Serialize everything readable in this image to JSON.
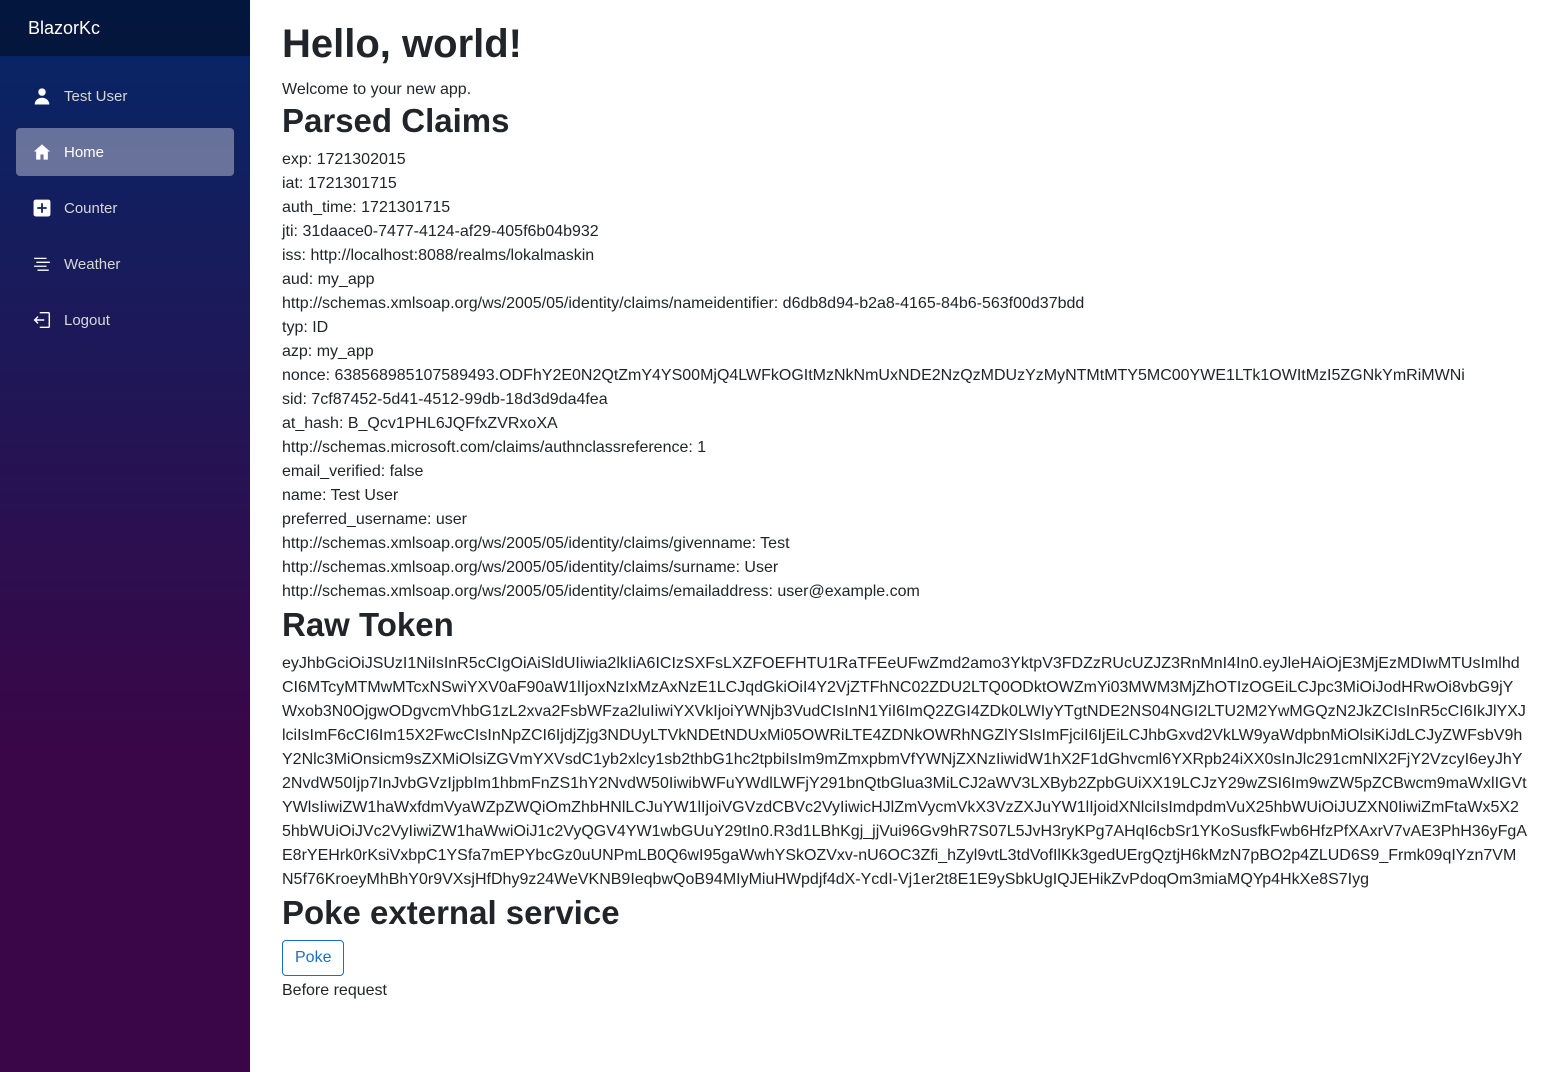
{
  "app": {
    "brand": "BlazorKc"
  },
  "sidebar": {
    "items": [
      {
        "label": "Test User",
        "icon": "person-icon",
        "active": false
      },
      {
        "label": "Home",
        "icon": "home-icon",
        "active": true
      },
      {
        "label": "Counter",
        "icon": "plus-square-icon",
        "active": false
      },
      {
        "label": "Weather",
        "icon": "list-icon",
        "active": false
      },
      {
        "label": "Logout",
        "icon": "logout-icon",
        "active": false
      }
    ]
  },
  "main": {
    "title": "Hello, world!",
    "welcome": "Welcome to your new app.",
    "claims_heading": "Parsed Claims",
    "claims": [
      "exp: 1721302015",
      "iat: 1721301715",
      "auth_time: 1721301715",
      "jti: 31daace0-7477-4124-af29-405f6b04b932",
      "iss: http://localhost:8088/realms/lokalmaskin",
      "aud: my_app",
      "http://schemas.xmlsoap.org/ws/2005/05/identity/claims/nameidentifier: d6db8d94-b2a8-4165-84b6-563f00d37bdd",
      "typ: ID",
      "azp: my_app",
      "nonce: 638568985107589493.ODFhY2E0N2QtZmY4YS00MjQ4LWFkOGItMzNkNmUxNDE2NzQzMDUzYzMyNTMtMTY5MC00YWE1LTk1OWItMzI5ZGNkYmRiMWNi",
      "sid: 7cf87452-5d41-4512-99db-18d3d9da4fea",
      "at_hash: B_Qcv1PHL6JQFfxZVRxoXA",
      "http://schemas.microsoft.com/claims/authnclassreference: 1",
      "email_verified: false",
      "name: Test User",
      "preferred_username: user",
      "http://schemas.xmlsoap.org/ws/2005/05/identity/claims/givenname: Test",
      "http://schemas.xmlsoap.org/ws/2005/05/identity/claims/surname: User",
      "http://schemas.xmlsoap.org/ws/2005/05/identity/claims/emailaddress: user@example.com"
    ],
    "raw_token_heading": "Raw Token",
    "raw_token": "eyJhbGciOiJSUzI1NiIsInR5cCIgOiAiSldUIiwia2lkIiA6ICIzSXFsLXZFOEFHTU1RaTFEeUFwZmd2amo3YktpV3FDZzRUcUZJZ3RnMnI4In0.eyJleHAiOjE3MjEzMDIwMTUsImlhdCI6MTcyMTMwMTcxNSwiYXV0aF90aW1lIjoxNzIxMzAxNzE1LCJqdGkiOiI4Y2VjZTFhNC02ZDU2LTQ0ODktOWZmYi03MWM3MjZhOTIzOGEiLCJpc3MiOiJodHRwOi8vbG9jYWxob3N0OjgwODgvcmVhbG1zL2xva2FsbWFza2luIiwiYXVkIjoiYWNjb3VudCIsInN1YiI6ImQ2ZGI4ZDk0LWIyYTgtNDE2NS04NGI2LTU2M2YwMGQzN2JkZCIsInR5cCI6IkJlYXJlciIsImF6cCI6Im15X2FwcCIsInNpZCI6IjdjZjg3NDUyLTVkNDEtNDUxMi05OWRiLTE4ZDNkOWRhNGZlYSIsImFjciI6IjEiLCJhbGxvd2VkLW9yaWdpbnMiOlsiKiJdLCJyZWFsbV9hY2Nlc3MiOnsicm9sZXMiOlsiZGVmYXVsdC1yb2xlcy1sb2thbG1hc2tpbiIsIm9mZmxpbmVfYWNjZXNzIiwidW1hX2F1dGhvcml6YXRpb24iXX0sInJlc291cmNlX2FjY2VzcyI6eyJhY2NvdW50Ijp7InJvbGVzIjpbIm1hbmFnZS1hY2NvdW50IiwibWFuYWdlLWFjY291bnQtbGlua3MiLCJ2aWV3LXByb2ZpbGUiXX19LCJzY29wZSI6Im9wZW5pZCBwcm9maWxlIGVtYWlsIiwiZW1haWxfdmVyaWZpZWQiOmZhbHNlLCJuYW1lIjoiVGVzdCBVc2VyIiwicHJlZmVycmVkX3VzZXJuYW1lIjoidXNlciIsImdpdmVuX25hbWUiOiJUZXN0IiwiZmFtaWx5X25hbWUiOiJVc2VyIiwiZW1haWwiOiJ1c2VyQGV4YW1wbGUuY29tIn0.R3d1LBhKgj_jjVui96Gv9hR7S07L5JvH3ryKPg7AHqI6cbSr1YKoSusfkFwb6HfzPfXAxrV7vAE3PhH36yFgAE8rYEHrk0rKsiVxbpC1YSfa7mEPYbcGz0uUNPmLB0Q6wI95gaWwhYSkOZVxv-nU6OC3Zfi_hZyl9vtL3tdVofIlKk3gedUErgQztjH6kMzN7pBO2p4ZLUD6S9_Frmk09qIYzn7VMN5f76KroeyMhBhY0r9VXsjHfDhy9z24WeVKNB9IeqbwQoB94MIyMiuHWpdjf4dX-YcdI-Vj1er2t8E1E9ySbkUgIQJEHikZvPdoqOm3miaMQYp4HkXe8S7Iyg",
    "poke_heading": "Poke external service",
    "poke_button": "Poke",
    "poke_status": "Before request"
  },
  "colors": {
    "sidebar_top": "#052767",
    "sidebar_bottom": "#3a0647",
    "button_accent": "#1b6ec2"
  }
}
